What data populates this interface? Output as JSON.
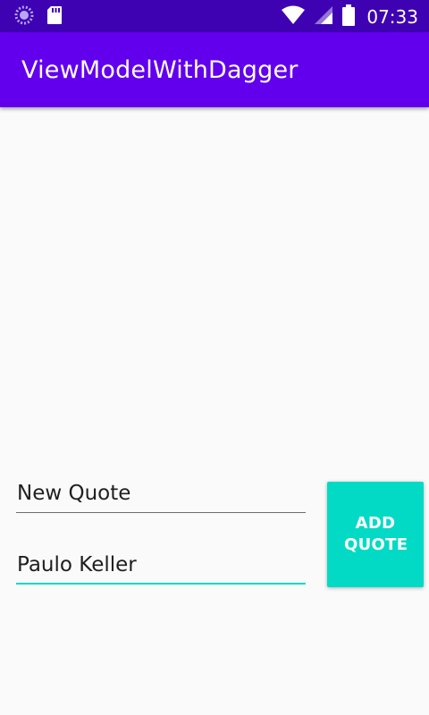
{
  "status_bar": {
    "time": "07:33",
    "icons": [
      "loading-spinner-icon",
      "sd-card-icon",
      "wifi-icon",
      "cell-signal-icon",
      "battery-icon"
    ]
  },
  "app_bar": {
    "title": "ViewModelWithDagger"
  },
  "form": {
    "quote_value": "New Quote",
    "author_value": "Paulo Keller",
    "add_button_label": "ADD QUOTE"
  },
  "colors": {
    "status_bar": "#3e02b3",
    "app_bar": "#6200ee",
    "accent": "#03dac5",
    "background": "#fafafa"
  }
}
